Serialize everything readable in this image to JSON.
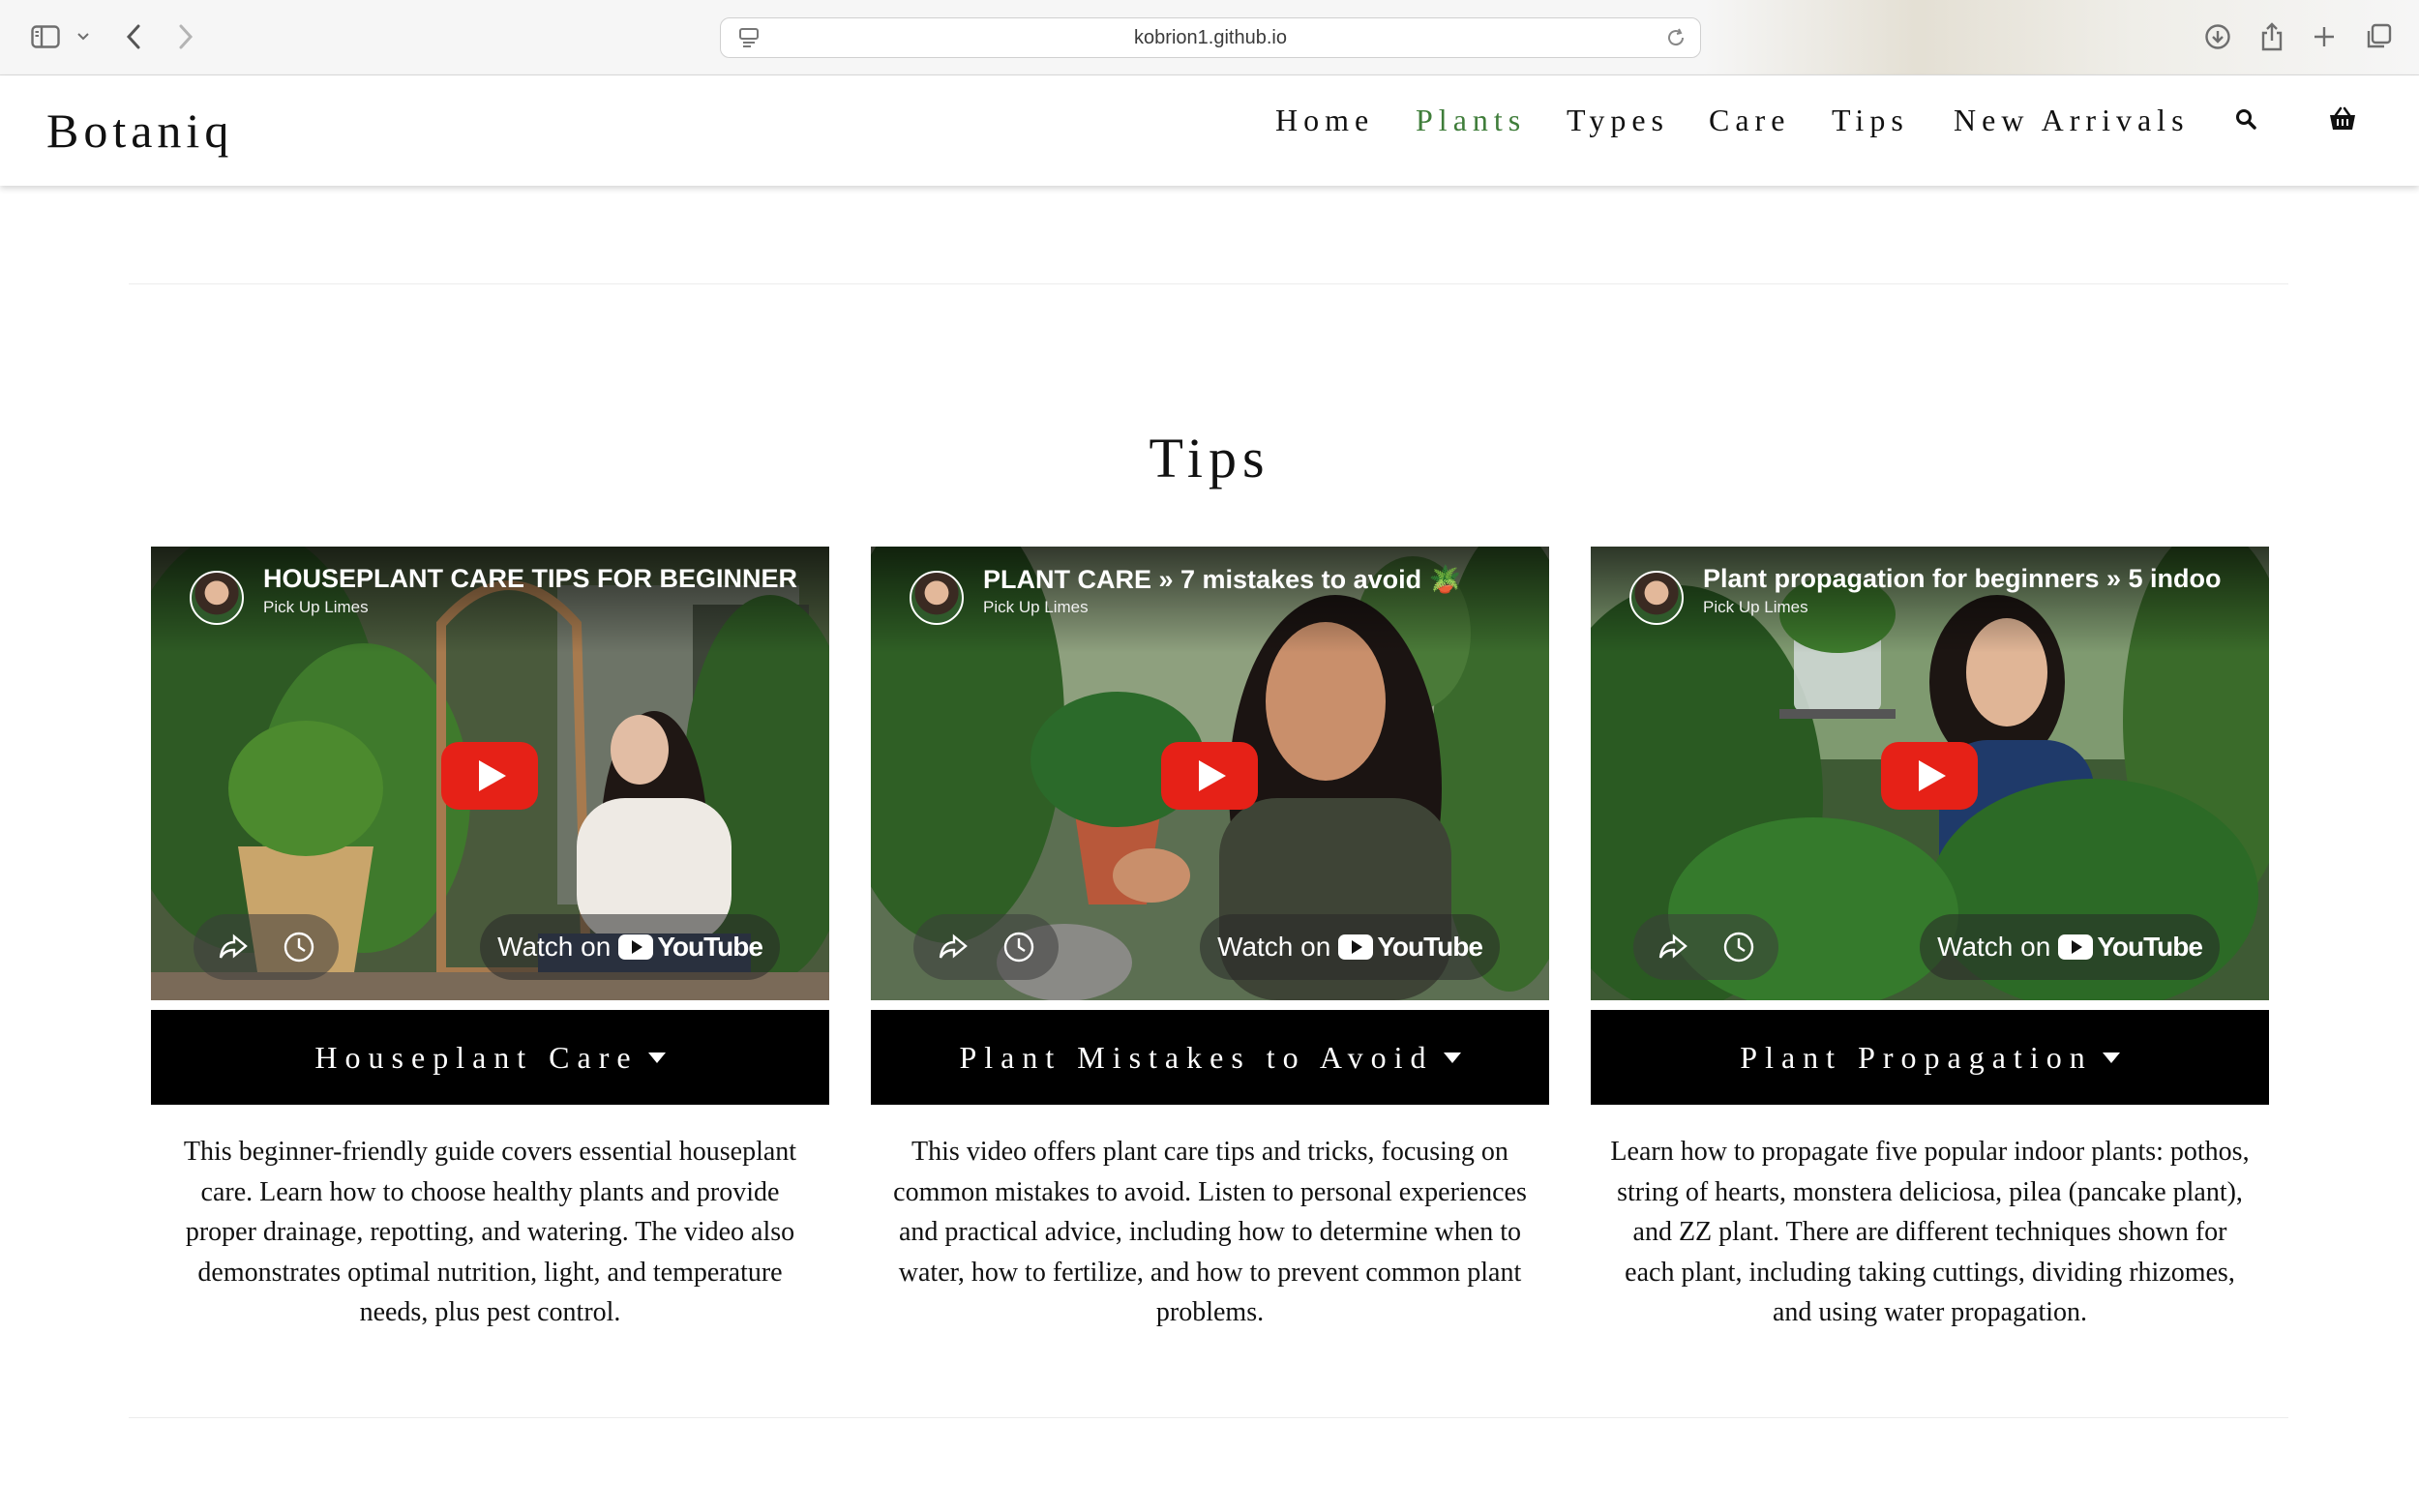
{
  "browser": {
    "url": "kobrion1.github.io",
    "icons": [
      "sidebar-icon",
      "chevron-down-icon",
      "back-icon",
      "forward-icon",
      "site-settings-icon",
      "reload-icon",
      "download-icon",
      "share-icon",
      "new-tab-icon",
      "tabs-overview-icon"
    ]
  },
  "site": {
    "logo": "Botaniq",
    "nav": [
      {
        "label": "Home",
        "active": false
      },
      {
        "label": "Plants",
        "active": true
      },
      {
        "label": "Types",
        "active": false
      },
      {
        "label": "Care",
        "active": false
      },
      {
        "label": "Tips",
        "active": false
      },
      {
        "label": "New Arrivals",
        "active": false
      }
    ],
    "header_icons": [
      "search-icon",
      "basket-icon"
    ],
    "accent_color": "#3f7d3a"
  },
  "tips": {
    "title": "Tips",
    "cards": [
      {
        "video_title": "HOUSEPLANT CARE TIPS FOR BEGINNER",
        "channel": "Pick Up Limes",
        "watch_label": "Watch on",
        "youtube_label": "YouTube",
        "button_label": "Houseplant Care",
        "description": "This beginner-friendly guide covers essential houseplant care. Learn how to choose healthy plants and provide proper drainage, repotting, and watering. The video also demonstrates optimal nutrition, light, and temperature needs, plus pest control."
      },
      {
        "video_title": "PLANT CARE » 7 mistakes to avoid 🪴",
        "channel": "Pick Up Limes",
        "watch_label": "Watch on",
        "youtube_label": "YouTube",
        "button_label": "Plant Mistakes to Avoid",
        "description": "This video offers plant care tips and tricks, focusing on common mistakes to avoid. Listen to personal experiences and practical advice, including how to determine when to water, how to fertilize, and how to prevent common plant problems."
      },
      {
        "video_title": "Plant propagation for beginners » 5 indoo",
        "channel": "Pick Up Limes",
        "watch_label": "Watch on",
        "youtube_label": "YouTube",
        "button_label": "Plant Propagation",
        "description": "Learn how to propagate five popular indoor plants: pothos, string of hearts, monstera deliciosa, pilea (pancake plant), and ZZ plant. There are different techniques shown for each plant, including taking cuttings, dividing rhizomes, and using water propagation."
      }
    ]
  }
}
